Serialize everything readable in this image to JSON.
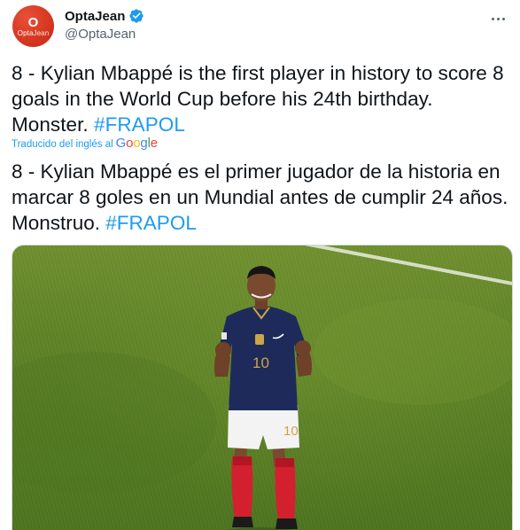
{
  "author": {
    "display_name": "OptaJean",
    "handle": "@OptaJean",
    "avatar": {
      "mark": "O",
      "text_bold": "Opta",
      "text_light": "Jean",
      "color": "#d5361f"
    },
    "verified": true,
    "verified_icon": "verified-badge-icon",
    "more_icon": "more-options-icon"
  },
  "tweet": {
    "text": "8 - Kylian Mbappé is the first player in history to score 8 goals in the World Cup before his 24th birthday. Monster. ",
    "hashtag": "#FRAPOL",
    "translation_label": "Traducido del inglés al",
    "translation_provider": {
      "letters": [
        "G",
        "o",
        "o",
        "g",
        "l",
        "e"
      ]
    },
    "translated_text": "8 - Kylian Mbappé es el primer jugador de la historia en marcar 8 goles en un Mundial antes de cumplir 24 años. Monstruo. ",
    "translated_hashtag": "#FRAPOL"
  },
  "media": {
    "player_number_shirt": "10",
    "player_number_shorts": "10"
  },
  "colors": {
    "link": "#1d9bf0",
    "text": "#0f1419",
    "secondary": "#536471",
    "verified": "#1d9bf0",
    "kit_blue": "#1e2a5a",
    "kit_gold": "#c9a64a",
    "socks_red": "#d3202e"
  }
}
